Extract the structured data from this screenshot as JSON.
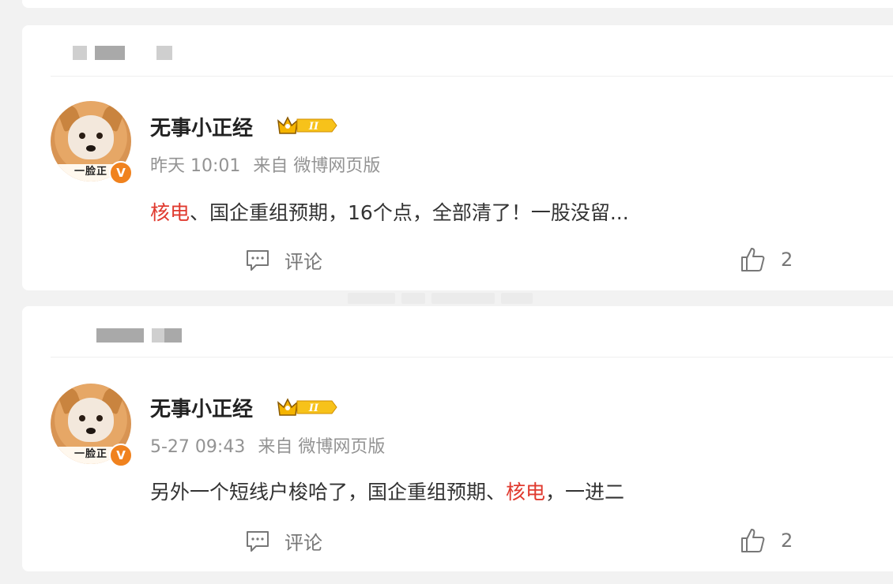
{
  "posts": [
    {
      "username": "无事小正经",
      "level_badge": "II",
      "avatar_caption": "一脸正",
      "verified_mark": "V",
      "time": "昨天 10:01",
      "source_prefix": "来自",
      "source": "微博网页版",
      "content_parts": [
        {
          "text": "核电",
          "highlight": true
        },
        {
          "text": "、国企重组预期，16个点，全部清了！一股没留...",
          "highlight": false
        }
      ],
      "comment_label": "评论",
      "like_count": "2",
      "icons": {
        "comment": "comment-icon",
        "like": "thumbs-up-icon",
        "crown": "crown-badge-icon"
      }
    },
    {
      "username": "无事小正经",
      "level_badge": "II",
      "avatar_caption": "一脸正",
      "verified_mark": "V",
      "time": "5-27 09:43",
      "source_prefix": "来自",
      "source": "微博网页版",
      "content_parts": [
        {
          "text": "另外一个短线户梭哈了，国企重组预期、",
          "highlight": false
        },
        {
          "text": "核电",
          "highlight": true
        },
        {
          "text": "，一进二",
          "highlight": false
        }
      ],
      "comment_label": "评论",
      "like_count": "2",
      "icons": {
        "comment": "comment-icon",
        "like": "thumbs-up-icon",
        "crown": "crown-badge-icon"
      }
    }
  ],
  "colors": {
    "highlight": "#e03a2f",
    "meta": "#939393",
    "verified": "#f0821e",
    "crown": "#f5b400"
  }
}
